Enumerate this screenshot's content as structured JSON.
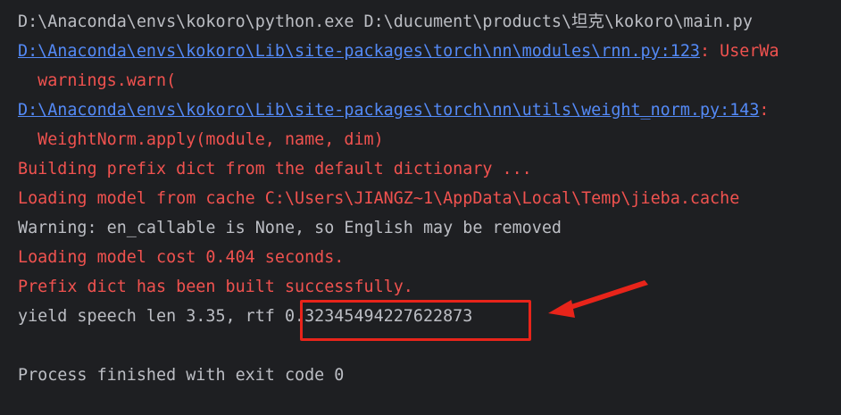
{
  "colors": {
    "background": "#1e1f22",
    "default_text": "#bcbec4",
    "error_text": "#f0524f",
    "link_text": "#548af7",
    "annotation_red": "#e8241a"
  },
  "console": {
    "lines": [
      {
        "kind": "text",
        "color": "default",
        "text": "D:\\Anaconda\\envs\\kokoro\\python.exe D:\\ducument\\products\\坦克\\kokoro\\main.py"
      },
      {
        "kind": "link",
        "link": "D:\\Anaconda\\envs\\kokoro\\Lib\\site-packages\\torch\\nn\\modules\\rnn.py:123",
        "rest": ": UserWa"
      },
      {
        "kind": "text",
        "color": "error",
        "text": "  warnings.warn("
      },
      {
        "kind": "link",
        "link": "D:\\Anaconda\\envs\\kokoro\\Lib\\site-packages\\torch\\nn\\utils\\weight_norm.py:143",
        "rest": ":"
      },
      {
        "kind": "text",
        "color": "error",
        "text": "  WeightNorm.apply(module, name, dim)"
      },
      {
        "kind": "text",
        "color": "error",
        "text": "Building prefix dict from the default dictionary ..."
      },
      {
        "kind": "text",
        "color": "error",
        "text": "Loading model from cache C:\\Users\\JIANGZ~1\\AppData\\Local\\Temp\\jieba.cache"
      },
      {
        "kind": "text",
        "color": "default",
        "text": "Warning: en_callable is None, so English may be removed"
      },
      {
        "kind": "text",
        "color": "error",
        "text": "Loading model cost 0.404 seconds."
      },
      {
        "kind": "text",
        "color": "error",
        "text": "Prefix dict has been built successfully."
      },
      {
        "kind": "text",
        "color": "default",
        "text": "yield speech len 3.35, rtf 0.32345494227622873"
      },
      {
        "kind": "text",
        "color": "default",
        "text": ""
      },
      {
        "kind": "text",
        "color": "default",
        "text": "Process finished with exit code 0"
      }
    ]
  },
  "annotation": {
    "highlighted_value": "0.32345494227622873"
  }
}
